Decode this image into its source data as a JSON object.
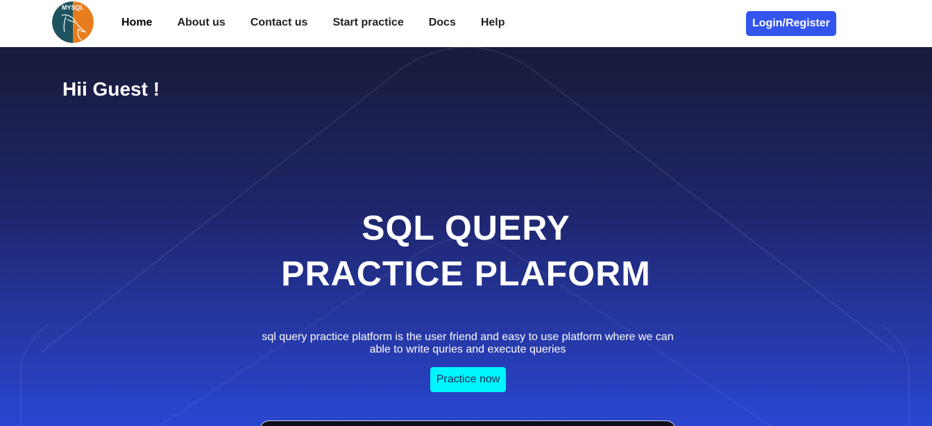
{
  "logo": {
    "text": "MYSQL",
    "colors": {
      "left": "#1d5360",
      "right": "#e87d1e"
    }
  },
  "nav": {
    "items": [
      {
        "label": "Home",
        "active": true
      },
      {
        "label": "About us"
      },
      {
        "label": "Contact us"
      },
      {
        "label": "Start practice"
      },
      {
        "label": "Docs"
      },
      {
        "label": "Help"
      }
    ],
    "login_label": "Login/Register"
  },
  "hero": {
    "greeting": "Hii Guest !",
    "title_line1": "SQL QUERY",
    "title_line2": "PRACTICE PLAFORM",
    "description": "sql query practice platform is the user friend and easy to use platform where we can able to write quries and execute queries",
    "cta_label": "Practice now"
  },
  "colors": {
    "accent_button": "#3355ee",
    "cta_button": "#00f5ff",
    "hero_top": "#181b3a",
    "hero_bottom": "#2a46d2"
  }
}
